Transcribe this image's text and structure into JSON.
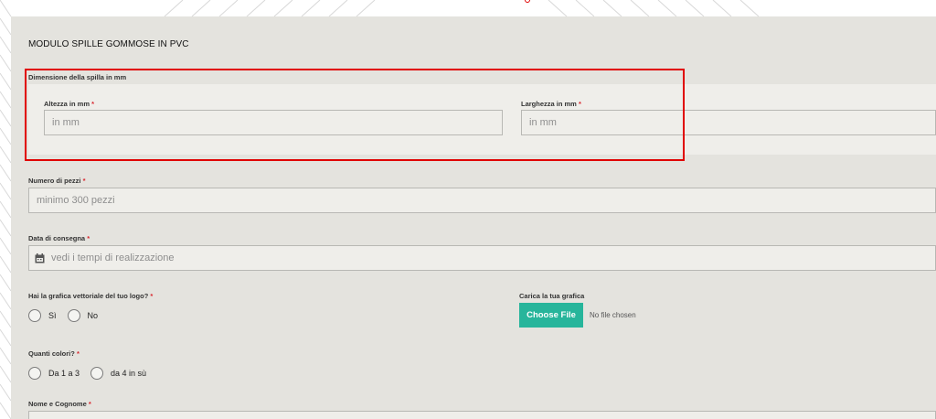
{
  "form": {
    "title": "MODULO SPILLE GOMMOSE IN PVC",
    "dimension_group": {
      "legend": "Dimensione della spilla in mm",
      "height": {
        "label": "Altezza in mm",
        "required": "*",
        "placeholder": "in mm",
        "value": ""
      },
      "width": {
        "label": "Larghezza in mm",
        "required": "*",
        "placeholder": "in mm",
        "value": ""
      }
    },
    "pieces": {
      "label": "Numero di pezzi",
      "required": "*",
      "placeholder": "minimo 300 pezzi",
      "value": ""
    },
    "delivery": {
      "label": "Data di consegna",
      "required": "*",
      "placeholder": "vedi i tempi di realizzazione",
      "value": "",
      "icon": "calendar-icon"
    },
    "vector": {
      "label": "Hai la grafica vettoriale del tuo logo?",
      "required": "*",
      "options": [
        "Sì",
        "No"
      ]
    },
    "upload": {
      "label": "Carica la tua grafica",
      "button_label": "Choose File",
      "status": "No file chosen"
    },
    "colors": {
      "label": "Quanti colori?",
      "required": "*",
      "options": [
        "Da 1 a 3",
        "da 4 in sù"
      ]
    },
    "name": {
      "label": "Nome e Cognome",
      "required": "*",
      "value": ""
    }
  },
  "colors": {
    "panel_bg": "#e4e3de",
    "accent_button": "#27b59b",
    "required_marker": "#d9272e",
    "highlight": "#e00000"
  }
}
